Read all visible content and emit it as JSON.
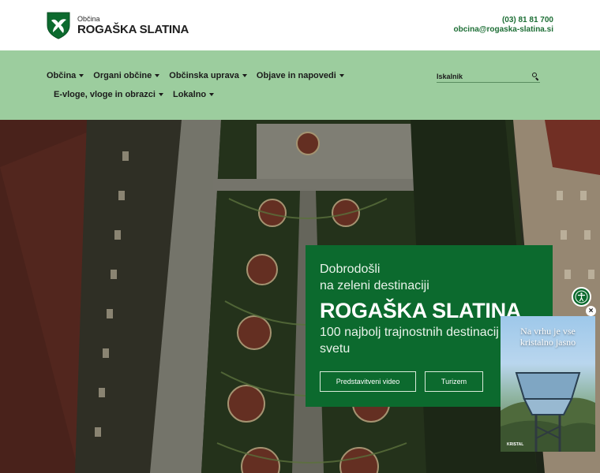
{
  "header": {
    "logo_small": "Občina",
    "logo_big": "ROGAŠKA SLATINA",
    "phone": "(03) 81 81 700",
    "email": "obcina@rogaska-slatina.si"
  },
  "nav": {
    "items_row1": [
      {
        "label": "Občina"
      },
      {
        "label": "Organi občine"
      },
      {
        "label": "Občinska uprava"
      },
      {
        "label": "Objave in napovedi"
      }
    ],
    "items_row2": [
      {
        "label": "E-vloge, vloge in obrazci"
      },
      {
        "label": "Lokalno"
      }
    ],
    "search_placeholder": "Iskalnik"
  },
  "hero": {
    "line1": "Dobrodošli",
    "line2": "na zeleni destinaciji",
    "title": "ROGAŠKA SLATINA",
    "subtitle": "100 najbolj trajnostnih destinacij na svetu",
    "button_video": "Predstavitveni video",
    "button_tourism": "Turizem"
  },
  "ad": {
    "text_line1": "Na vrhu je vse",
    "text_line2": "kristalno jasno",
    "brand": "KRISTAL",
    "close": "×"
  },
  "colors": {
    "nav_bg": "#9ccd9e",
    "card_bg": "#0c6a2e",
    "contact_text": "#1d6e35"
  }
}
